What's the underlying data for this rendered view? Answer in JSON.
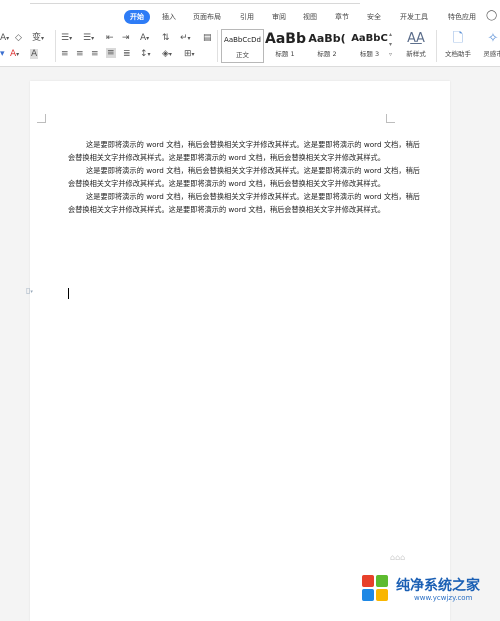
{
  "ribbon": {
    "tabs": [
      "开始",
      "插入",
      "页面布局",
      "引用",
      "审阅",
      "视图",
      "章节",
      "安全",
      "开发工具",
      "特色应用"
    ],
    "active_tab": "开始",
    "styles": [
      {
        "sample": "AaBbCcDd",
        "label": "正文"
      },
      {
        "sample": "AaBb",
        "label": "标题 1"
      },
      {
        "sample": "AaBb(",
        "label": "标题 2"
      },
      {
        "sample": "AaBbC",
        "label": "标题 3"
      }
    ],
    "new_style_label": "新样式",
    "doc_helper_label": "文档助手",
    "inspiration_label": "灵感市"
  },
  "document": {
    "paragraphs": [
      "这是要即将演示的 word 文档，稍后会替换相关文字并修改其样式。这是要即将演示的 word 文档，稍后会替换相关文字并修改其样式。这是要即将演示的 word 文档，稍后会替换相关文字并修改其样式。",
      "这是要即将演示的 word 文档，稍后会替换相关文字并修改其样式。这是要即将演示的 word 文档，稍后会替换相关文字并修改其样式。这是要即将演示的 word 文档，稍后会替换相关文字并修改其样式。",
      "这是要即将演示的 word 文档，稍后会替换相关文字并修改其样式。这是要即将演示的 word 文档，稍后会替换相关文字并修改其样式。这是要即将演示的 word 文档，稍后会替换相关文字并修改其样式。"
    ]
  },
  "watermark": {
    "title": "纯净系统之家",
    "url": "www.ycwjzy.com"
  },
  "colors": {
    "accent": "#2e7cf6",
    "logo_blue": "#1a5fb4"
  }
}
